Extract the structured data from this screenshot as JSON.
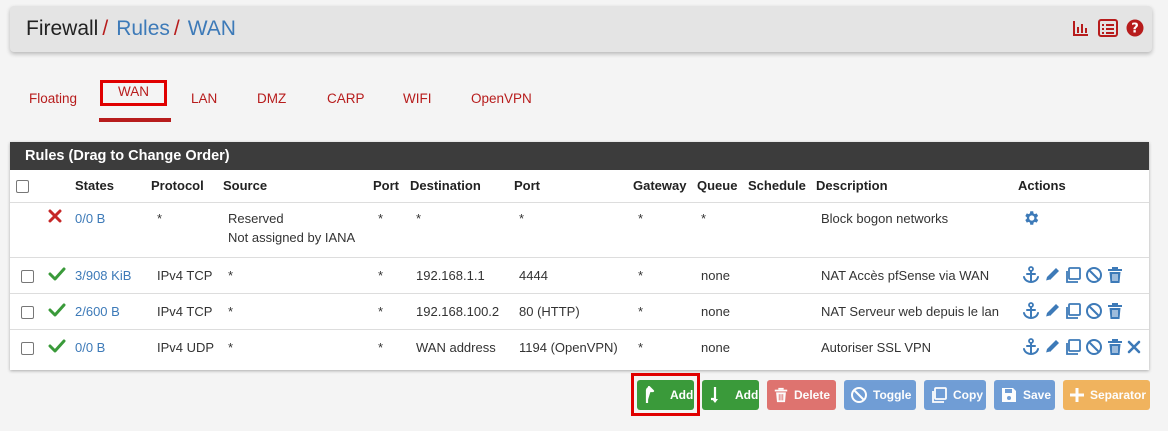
{
  "breadcrumb": {
    "root": "Firewall",
    "sep1": "/",
    "rules": "Rules",
    "sep2": "/",
    "current": "WAN"
  },
  "header_icons": [
    "chart-bar-icon",
    "list-icon",
    "help-icon"
  ],
  "tabs": [
    {
      "label": "Floating"
    },
    {
      "label": "WAN"
    },
    {
      "label": "LAN"
    },
    {
      "label": "DMZ"
    },
    {
      "label": "CARP"
    },
    {
      "label": "WIFI"
    },
    {
      "label": "OpenVPN"
    }
  ],
  "panel": {
    "title": "Rules (Drag to Change Order)",
    "columns": [
      "States",
      "Protocol",
      "Source",
      "Port",
      "Destination",
      "Port",
      "Gateway",
      "Queue",
      "Schedule",
      "Description",
      "Actions"
    ]
  },
  "rows": [
    {
      "status": "block",
      "states": "0/0 B",
      "protocol": "*",
      "source_line1": "Reserved",
      "source_line2": "Not assigned by IANA",
      "sport": "*",
      "destination": "*",
      "dport": "*",
      "gateway": "*",
      "queue": "*",
      "schedule": "",
      "description": "Block bogon networks"
    },
    {
      "status": "pass",
      "states": "3/908 KiB",
      "protocol": "IPv4 TCP",
      "source": "*",
      "sport": "*",
      "destination": "192.168.1.1",
      "dport": "4444",
      "gateway": "*",
      "queue": "none",
      "schedule": "",
      "description": "NAT Accès pfSense via WAN"
    },
    {
      "status": "pass",
      "states": "2/600 B",
      "protocol": "IPv4 TCP",
      "source": "*",
      "sport": "*",
      "destination": "192.168.100.2",
      "dport": "80 (HTTP)",
      "gateway": "*",
      "queue": "none",
      "schedule": "",
      "description": "NAT Serveur web depuis le lan"
    },
    {
      "status": "pass",
      "states": "0/0 B",
      "protocol": "IPv4 UDP",
      "source": "*",
      "sport": "*",
      "destination": "WAN address",
      "dport": "1194 (OpenVPN)",
      "gateway": "*",
      "queue": "none",
      "schedule": "",
      "description": "Autoriser SSL VPN"
    }
  ],
  "buttons": {
    "add_top": "Add",
    "add_bottom": "Add",
    "delete": "Delete",
    "toggle": "Toggle",
    "copy": "Copy",
    "save": "Save",
    "separator": "Separator"
  },
  "colors": {
    "accent_red": "#b71c1c",
    "link_blue": "#3d7ab8",
    "pass_green": "#3a9a3a",
    "block_red": "#c62828",
    "heading_dark": "#3c3c3c"
  }
}
